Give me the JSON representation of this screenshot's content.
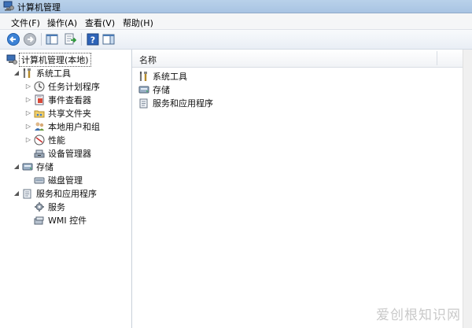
{
  "window": {
    "title": "计算机管理"
  },
  "menu": [
    {
      "label": "文件(F)"
    },
    {
      "label": "操作(A)"
    },
    {
      "label": "查看(V)"
    },
    {
      "label": "帮助(H)"
    }
  ],
  "toolbar": {
    "buttons": [
      "back-arrow-icon",
      "forward-arrow-icon",
      "show-hide-tree-icon",
      "export-list-icon",
      "help-icon",
      "show-hide-action-pane-icon"
    ]
  },
  "tree": {
    "root": "计算机管理(本地)",
    "system_tools": "系统工具",
    "task_scheduler": "任务计划程序",
    "event_viewer": "事件查看器",
    "shared_folders": "共享文件夹",
    "local_users_groups": "本地用户和组",
    "performance": "性能",
    "device_manager": "设备管理器",
    "storage": "存储",
    "disk_management": "磁盘管理",
    "services_apps": "服务和应用程序",
    "services": "服务",
    "wmi_control": "WMI 控件"
  },
  "list": {
    "column_name": "名称",
    "items": [
      "系统工具",
      "存储",
      "服务和应用程序"
    ]
  },
  "watermark": "爱创根知识网"
}
